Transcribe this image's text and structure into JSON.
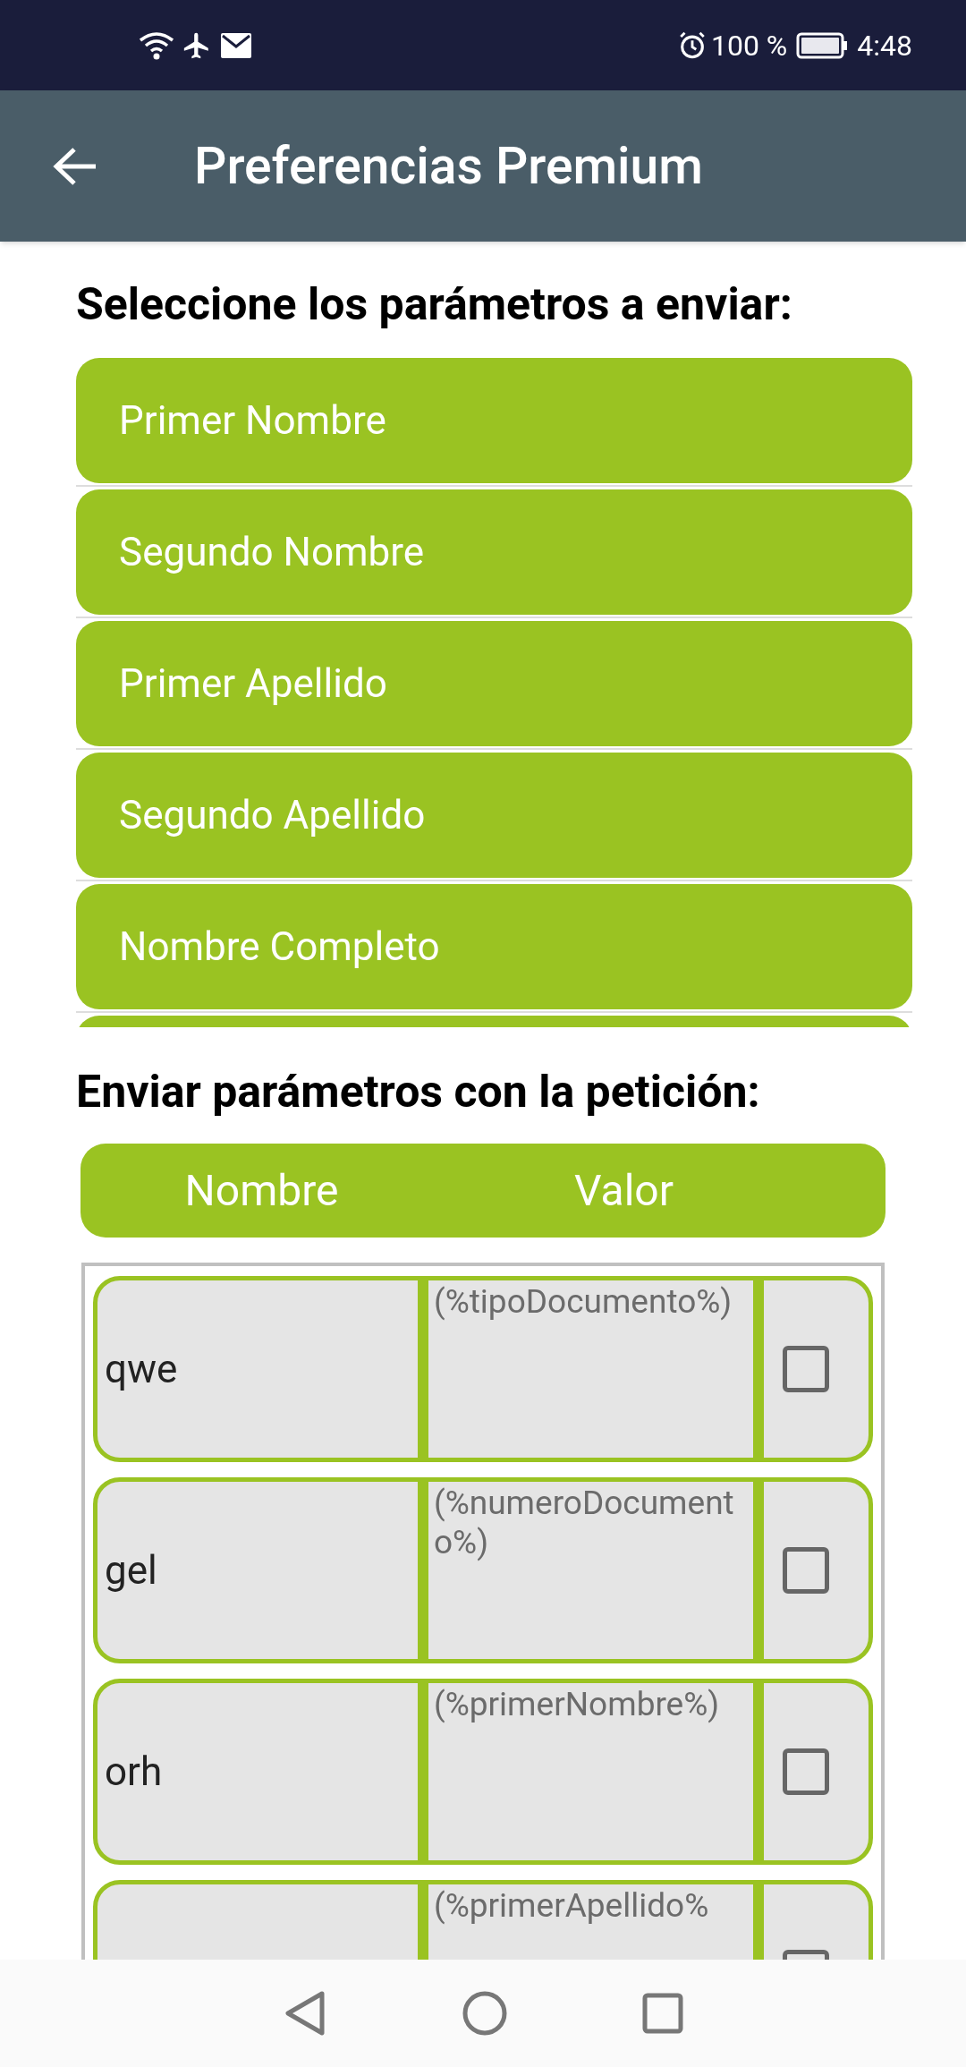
{
  "status_bar": {
    "battery": "100 %",
    "time": "4:48"
  },
  "app_bar": {
    "title": "Preferencias Premium"
  },
  "parameters_heading": "Seleccione los parámetros a enviar:",
  "parameters": [
    {
      "label": "Primer Nombre"
    },
    {
      "label": "Segundo Nombre"
    },
    {
      "label": "Primer Apellido"
    },
    {
      "label": "Segundo Apellido"
    },
    {
      "label": "Nombre Completo"
    }
  ],
  "request_heading": "Enviar parámetros con la petición:",
  "table": {
    "columns": [
      "Nombre",
      "Valor"
    ],
    "rows": [
      {
        "name": "qwe",
        "value": "(%tipoDocumento%)",
        "checked": false
      },
      {
        "name": "gel",
        "value": "(%numeroDocumento%)",
        "checked": false
      },
      {
        "name": "orh",
        "value": "(%primerNombre%)",
        "checked": false
      },
      {
        "value": "(%primerApellido%",
        "checked": false
      }
    ]
  }
}
